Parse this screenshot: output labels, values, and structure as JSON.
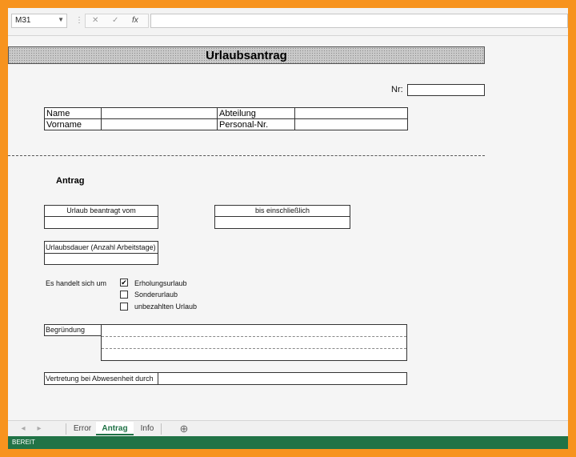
{
  "formula_bar": {
    "name_box": "M31",
    "cancel_icon": "✕",
    "confirm_icon": "✓",
    "fx_label": "fx",
    "formula": ""
  },
  "form": {
    "title": "Urlaubsantrag",
    "nr_label": "Nr:",
    "nr_value": "",
    "name_label": "Name",
    "name_value": "",
    "abteilung_label": "Abteilung",
    "abteilung_value": "",
    "vorname_label": "Vorname",
    "vorname_value": "",
    "personal_nr_label": "Personal-Nr.",
    "personal_nr_value": "",
    "section_heading": "Antrag",
    "urlaub_vom_label": "Urlaub beantragt vom",
    "urlaub_vom_value": "",
    "bis_label": "bis einschließlich",
    "bis_value": "",
    "dauer_label": "Urlaubsdauer (Anzahl Arbeitstage)",
    "dauer_value": "",
    "type_question": "Es handelt sich um",
    "options": [
      {
        "label": "Erholungsurlaub",
        "checked": true
      },
      {
        "label": "Sonderurlaub",
        "checked": false
      },
      {
        "label": "unbezahlten Urlaub",
        "checked": false
      }
    ],
    "begruendung_label": "Begründung",
    "vertretung_label": "Vertretung bei Abwesenheit durch",
    "vertretung_value": ""
  },
  "sheet_tabs": {
    "tabs": [
      "Error",
      "Antrag",
      "Info"
    ],
    "active": "Antrag",
    "add_icon": "⊕"
  },
  "status": {
    "text": "BEREIT"
  },
  "colors": {
    "frame": "#f7931e",
    "status_bar": "#217346",
    "active_tab": "#1e7145"
  }
}
